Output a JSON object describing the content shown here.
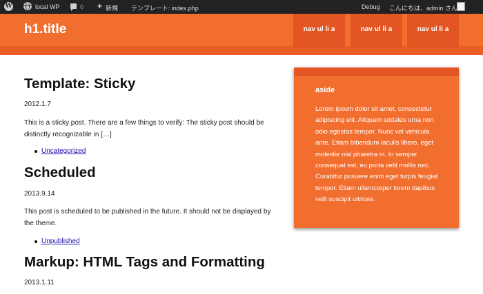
{
  "admin_bar": {
    "wp_logo_icon": "wordpress-logo-icon",
    "site_name": "local WP",
    "comments_count": "0",
    "new_label": "新規",
    "template_label": "テンプレート: index.php",
    "debug_label": "Debug",
    "greeting": "こんにちは、admin さん！"
  },
  "header": {
    "title": "h1.title",
    "nav": [
      "nav ul li a",
      "nav ul li a",
      "nav ul li a"
    ]
  },
  "posts": [
    {
      "title": "Template: Sticky",
      "date": "2012.1.7",
      "excerpt": "This is a sticky post. There are a few things to verify: The sticky post should be distinctly recognizable in […]",
      "category": "Uncategorized"
    },
    {
      "title": "Scheduled",
      "date": "2013.9.14",
      "excerpt": "This post is scheduled to be published in the future. It should not be displayed by the theme.",
      "category": "Unpublished"
    },
    {
      "title": "Markup: HTML Tags and Formatting",
      "date": "2013.1.11"
    }
  ],
  "aside": {
    "title": "aside",
    "text": "Lorem ipsum dolor sit amet, consectetur adipiscing elit. Aliquam sodales urna non odio egestas tempor. Nunc vel vehicula ante. Etiam bibendum iaculis libero, eget molestie nisl pharetra in. In semper consequat est, eu porta velit mollis nec. Curabitur posuere enim eget turpis feugiat tempor. Etiam ullamcorper lorem dapibus velit suscipit ultrices."
  },
  "colors": {
    "accent": "#f16e2f",
    "accent_dark": "#e35522",
    "admin_bar": "#222222",
    "link": "#1a0dab"
  }
}
